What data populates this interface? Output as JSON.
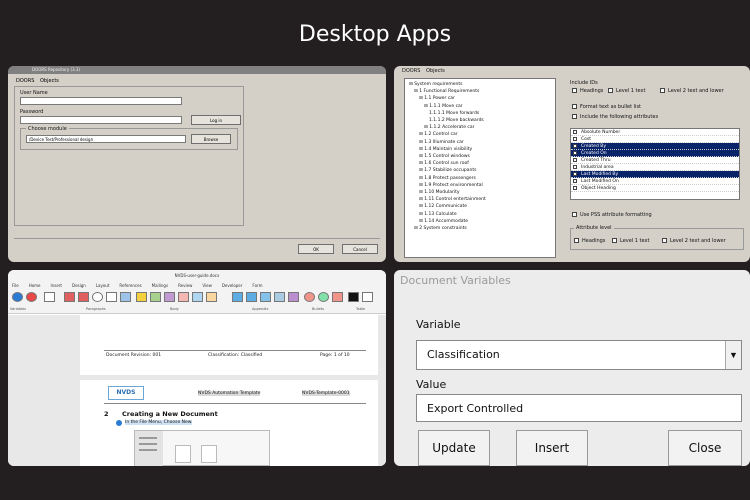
{
  "heading": "Desktop Apps",
  "panel1": {
    "window_title": "DOORS Repository (3.3)",
    "tabs": [
      "DOORS",
      "Objects"
    ],
    "user_name_label": "User Name",
    "password_label": "Password",
    "choose_module_label": "Choose module",
    "module_path": "/Device Test/Professional design",
    "login_btn": "Log in",
    "browse_btn": "Browse",
    "ok_btn": "OK",
    "cancel_btn": "Cancel"
  },
  "panel2": {
    "tabs": [
      "DOORS",
      "Objects"
    ],
    "tree": [
      "System requirements",
      "1 Functional Requirements",
      "1.1 Power car",
      "1.1.1 Move car",
      "1.1.1.1 Move forwards",
      "1.1.1.2 Move backwards",
      "1.1.2 Accelerate car",
      "1.2 Control car",
      "1.3 Illuminate car",
      "1.4 Maintain visibility",
      "1.5 Control windows",
      "1.6 Control sun roof",
      "1.7 Stabilize occupants",
      "1.8 Protect passengers",
      "1.9 Protect environmental",
      "1.10 Modularity",
      "1.11 Control entertainment",
      "1.12 Communicate",
      "1.13 Calculate",
      "1.14 Accommodate",
      "2 System constraints"
    ],
    "include_ids_label": "Include IDs",
    "headings": "Headings",
    "level1": "Level 1 text",
    "level2": "Level 2 text and lower",
    "format_bullet": "Format text as bullet list",
    "include_attrs": "Include the following attributes",
    "attributes": [
      "Absolute Number",
      "Cost",
      "Created By",
      "Created On",
      "Created Thru",
      "Industrial area",
      "Last Modified By",
      "Last Modified On",
      "Object Heading"
    ],
    "pss_format": "Use PSS attribute formatting",
    "attr_level_label": "Attribute level"
  },
  "panel3": {
    "doc_title": "NVDS-user-guide.docx",
    "ribbon_tabs": [
      "File",
      "Home",
      "Insert",
      "Design",
      "Layout",
      "References",
      "Mailings",
      "Review",
      "View",
      "Developer",
      "Form"
    ],
    "group_labels": [
      "Variables",
      "Paragraphs",
      "Body",
      "Appendix",
      "Bullets",
      "Table"
    ],
    "footer_revision": "Document Revision: 001",
    "footer_classification": "Classification: Classified",
    "footer_page": "Page: 1 of 10",
    "logo": "NVDS",
    "header_template": "NVDS Automation Template",
    "header_template_id": "NVDS-Template-0001",
    "section_number": "2",
    "section_heading": "Creating a New Document",
    "step_text": "In the File Menu, Choose New."
  },
  "panel4": {
    "window_title": "Document Variables",
    "variable_label": "Variable",
    "variable_value": "Classification",
    "value_label": "Value",
    "value_text": "Export Controlled",
    "update_btn": "Update",
    "insert_btn": "Insert",
    "close_btn": "Close"
  }
}
